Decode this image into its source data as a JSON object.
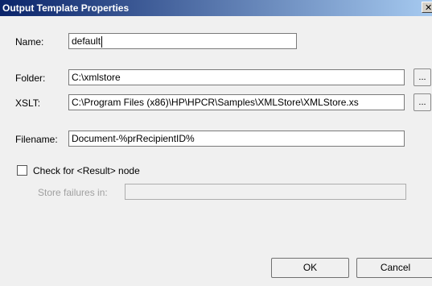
{
  "window": {
    "title": "Output Template Properties",
    "close_glyph": "✕"
  },
  "fields": {
    "name": {
      "label": "Name:",
      "value": "default"
    },
    "folder": {
      "label": "Folder:",
      "value": "C:\\xmlstore",
      "browse": "..."
    },
    "xslt": {
      "label": "XSLT:",
      "value": "C:\\Program Files (x86)\\HP\\HPCR\\Samples\\XMLStore\\XMLStore.xs",
      "browse": "..."
    },
    "filename": {
      "label": "Filename:",
      "value": "Document-%prRecipientID%"
    }
  },
  "check_result": {
    "label": "Check for <Result> node",
    "checked": false
  },
  "store_failures": {
    "label": "Store failures in:",
    "value": ""
  },
  "buttons": {
    "ok": "OK",
    "cancel": "Cancel"
  }
}
